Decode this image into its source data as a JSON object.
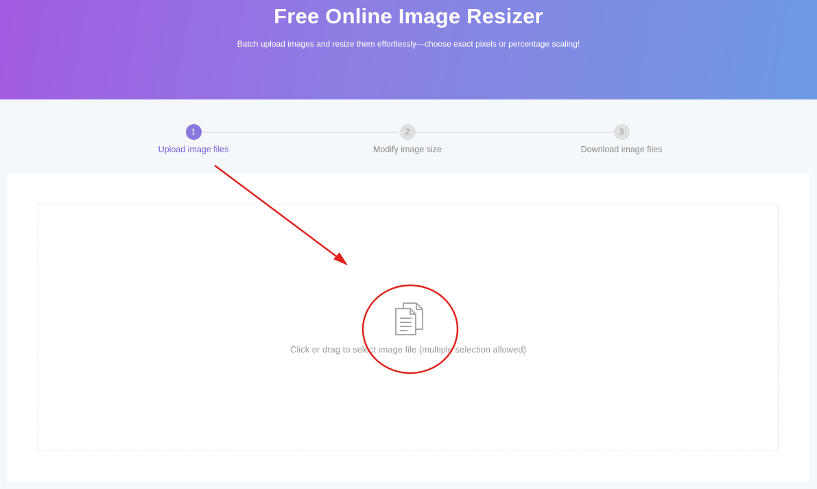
{
  "header": {
    "title": "Free Online Image Resizer",
    "subtitle": "Batch upload images and resize them effortlessly—choose exact pixels or percentage scaling!"
  },
  "steps": [
    {
      "number": "1",
      "label": "Upload image files",
      "active": true
    },
    {
      "number": "2",
      "label": "Modify image size",
      "active": false
    },
    {
      "number": "3",
      "label": "Download image files",
      "active": false
    }
  ],
  "upload": {
    "icon": "documents-icon",
    "instruction": "Click or drag to select image file (multiple selection allowed)"
  },
  "colors": {
    "gradient_start": "#a35be3",
    "gradient_end": "#6e9ae3",
    "active_step": "#8a78e0",
    "annotation": "#e0231c"
  }
}
